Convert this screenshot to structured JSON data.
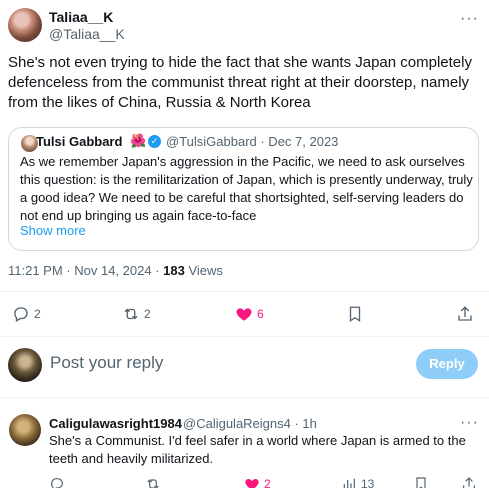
{
  "tweet": {
    "author_name": "Taliaa__K",
    "author_handle": "@Taliaa__K",
    "text": "She's not even trying to hide the fact that she wants Japan completely defenceless from the communist threat right at their doorstep, namely from the likes of China, Russia & North Korea",
    "more_icon": "more-dots-icon",
    "timestamp": "11:21 PM · Nov 14, 2024 · ",
    "views_count": "183",
    "views_label": " Views"
  },
  "quote": {
    "author_name": "Tulsi Gabbard",
    "flower": "🌺",
    "verified_icon": "verified-badge-icon",
    "handle_date": "@TulsiGabbard · Dec 7, 2023",
    "text": "As we remember Japan's aggression in the Pacific, we need to ask ourselves this question: is the remilitarization of Japan, which is presently underway, truly a good idea? We need to be careful that shortsighted, self-serving leaders do not end up bringing us again face-to-face",
    "show_more": "Show more"
  },
  "actions": {
    "replies": "2",
    "reposts": "2",
    "likes": "6",
    "like_color": "#f91880"
  },
  "reply_box": {
    "placeholder": "Post your reply",
    "button_label": "Reply",
    "button_color": "#8ecdf8"
  },
  "comment": {
    "author_name": "Caligulawasright1984",
    "handle_time": "@CaligulaReigns4 · 1h",
    "text": "She's a Communist.  I'd feel safer in a world where Japan is armed to the teeth and heavily militarized.",
    "likes": "2",
    "views": "13"
  },
  "colors": {
    "accent": "#1d9bf0",
    "secondary_text": "#536471",
    "border": "#cfd9de"
  }
}
